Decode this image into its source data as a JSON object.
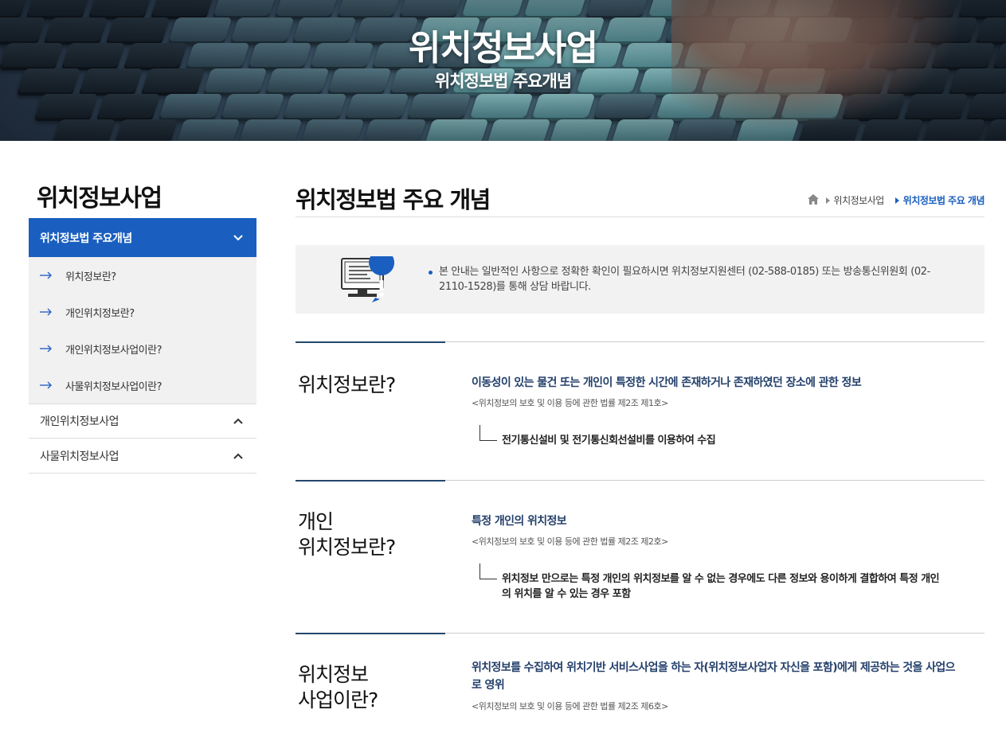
{
  "banner": {
    "title": "위치정보사업",
    "subtitle": "위치정보법 주요개념"
  },
  "sidebar": {
    "title": "위치정보사업",
    "active_item": {
      "label": "위치정보법 주요개념",
      "icon": "chevron-down-icon"
    },
    "sub_items": [
      {
        "label": "위치정보란?"
      },
      {
        "label": "개인위치정보란?"
      },
      {
        "label": "개인위치정보사업이란?"
      },
      {
        "label": "사물위치정보사업이란?"
      }
    ],
    "other_items": [
      {
        "label": "개인위치정보사업",
        "icon": "chevron-up-icon"
      },
      {
        "label": "사물위치정보사업",
        "icon": "chevron-up-icon"
      }
    ]
  },
  "main": {
    "title": "위치정보법 주요 개념",
    "breadcrumb": {
      "home_icon": "home-icon",
      "items": [
        "위치정보사업",
        "위치정보법 주요 개념"
      ]
    },
    "notice": {
      "icon": "monitor-alert-icon",
      "text": "본 안내는 일반적인 사항으로 정확한 확인이 필요하시면 위치정보지원센터 (02-588-0185) 또는 방송통신위원회 (02-2110-1528)를 통해 상담 바랍니다."
    },
    "sections": [
      {
        "title_line1": "위치정보란?",
        "title_line2": "",
        "definition": "이동성이 있는 물건 또는 개인이 특정한 시간에 존재하거나 존재하였던 장소에 관한 정보",
        "law": "<위치정보의 보호 및 이용 등에 관한 법률 제2조 제1호>",
        "note": "전기통신설비 및 전기통신회선설비를 이용하여 수집"
      },
      {
        "title_line1": "개인",
        "title_line2": "위치정보란?",
        "definition": "특정 개인의 위치정보",
        "law": "<위치정보의 보호 및 이용 등에 관한 법률 제2조 제2호>",
        "note": "위치정보 만으로는 특정 개인의 위치정보를 알 수 없는 경우에도 다른 정보와 용이하게 결합하여 특정 개인의 위치를 알 수 있는 경우 포함"
      },
      {
        "title_line1": "위치정보",
        "title_line2": "사업이란?",
        "definition": "위치정보를 수집하여 위치기반 서비스사업을 하는 자(위치정보사업자 자신을 포함)에게 제공하는 것을 사업으로 영위",
        "law": "<위치정보의 보호 및 이용 등에 관한 법률 제2조 제6호>",
        "note": ""
      }
    ]
  },
  "colors": {
    "accent": "#1a5fbf",
    "definition_text": "#24406b",
    "section_accent": "#24476e"
  }
}
